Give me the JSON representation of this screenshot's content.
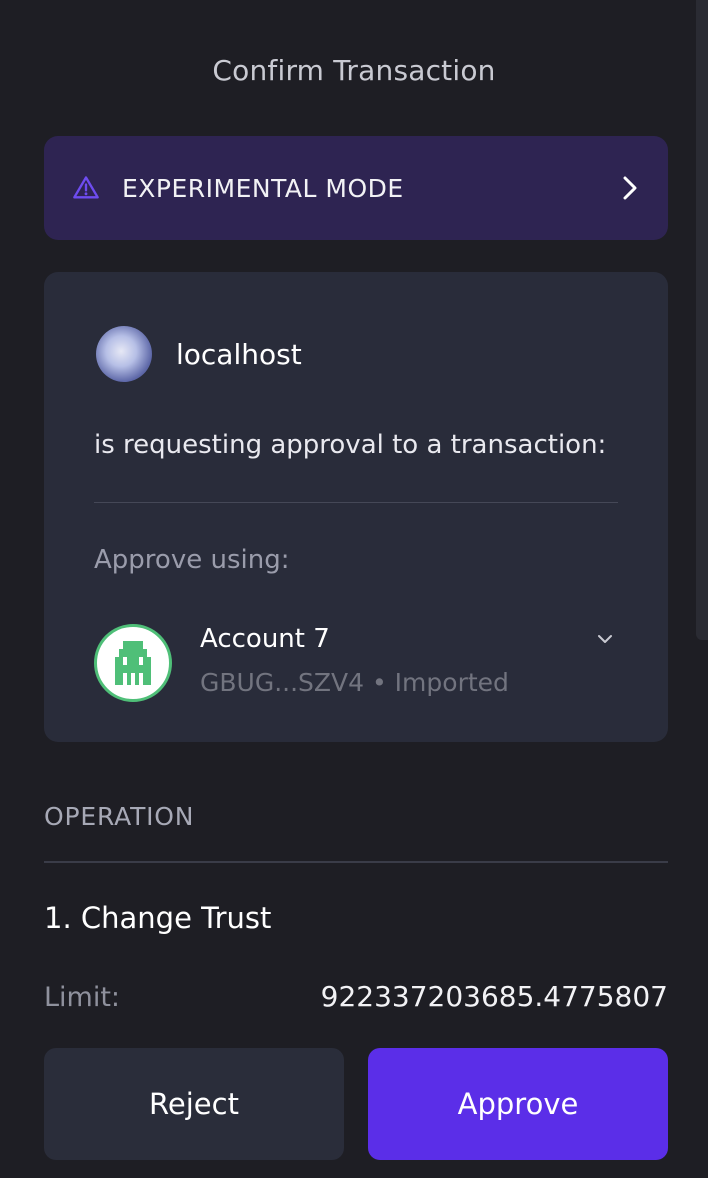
{
  "header": {
    "title": "Confirm Transaction"
  },
  "banner": {
    "label": "EXPERIMENTAL MODE",
    "icon": "warning-triangle-icon",
    "accent": "#6e4cf0"
  },
  "request": {
    "site": "localhost",
    "message": "is requesting approval to a transaction:",
    "approve_using_label": "Approve using:"
  },
  "account": {
    "name": "Account 7",
    "subtitle": "GBUG...SZV4 • Imported",
    "avatar_color": "#4fbf78"
  },
  "operation": {
    "section_label": "OPERATION",
    "title": "1. Change Trust",
    "limit_label": "Limit:",
    "limit_value": "922337203685.4775807"
  },
  "actions": {
    "reject_label": "Reject",
    "approve_label": "Approve",
    "approve_color": "#5b2ee8"
  }
}
